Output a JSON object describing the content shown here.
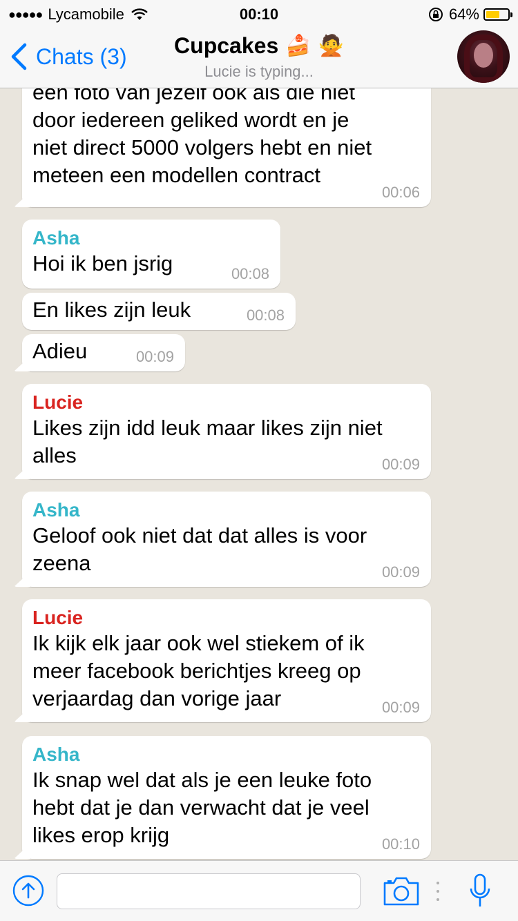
{
  "status_bar": {
    "carrier": "Lycamobile",
    "time": "00:10",
    "battery_percent": "64%",
    "battery_level": 0.64
  },
  "nav": {
    "back_label": "Chats (3)",
    "title": "Cupcakes",
    "title_emojis": [
      "🍰",
      "🙅"
    ],
    "subtitle": "Lucie is typing..."
  },
  "colors": {
    "accent": "#007aff",
    "asha": "#35b6c9",
    "lucie": "#d92420",
    "background": "#e9e5dd"
  },
  "messages": [
    {
      "sender": "",
      "text": "een foto van jezelf ook als die niet\ndoor iedereen geliked wordt en je\nniet direct 5000 volgers hebt en niet\nmeteen een modellen contract",
      "time": "00:06"
    },
    {
      "sender": "Asha",
      "text": "Hoi ik ben jsrig",
      "time": "00:08"
    },
    {
      "sender": "",
      "text": "En likes zijn leuk",
      "time": "00:08"
    },
    {
      "sender": "",
      "text": "Adieu",
      "time": "00:09"
    },
    {
      "sender": "Lucie",
      "text": "Likes zijn idd leuk maar likes zijn niet\nalles",
      "time": "00:09"
    },
    {
      "sender": "Asha",
      "text": "Geloof ook niet dat dat alles is voor\nzeena",
      "time": "00:09"
    },
    {
      "sender": "Lucie",
      "text": "Ik kijk elk jaar ook wel stiekem of ik\nmeer facebook berichtjes kreeg op\nverjaardag dan vorige jaar",
      "time": "00:09"
    },
    {
      "sender": "Asha",
      "text": "Ik snap wel dat als je een leuke foto\nhebt dat je dan verwacht dat je veel\nlikes erop krijg",
      "time": "00:10"
    }
  ],
  "input": {
    "value": "",
    "placeholder": ""
  },
  "icons": {
    "share": "share-upload-icon",
    "camera": "camera-icon",
    "mic": "microphone-icon"
  }
}
